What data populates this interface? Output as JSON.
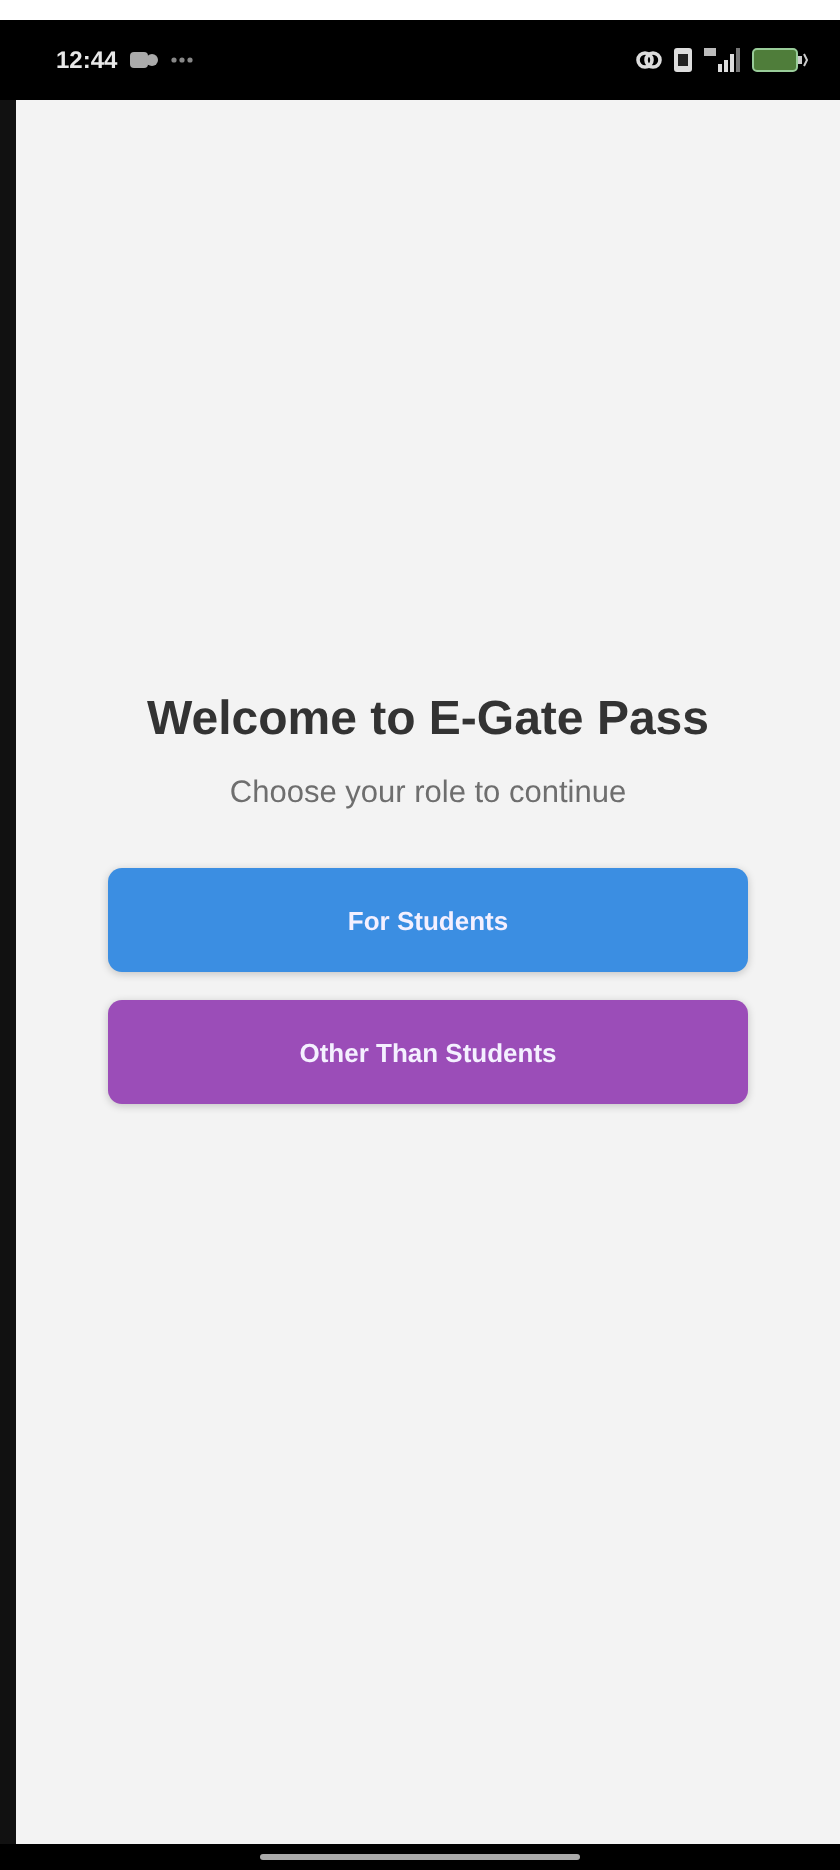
{
  "status_bar": {
    "time": "12:44"
  },
  "title": "Welcome to E-Gate Pass",
  "subtitle": "Choose your role to continue",
  "buttons": [
    {
      "label": "For Students",
      "color": "#3b8ee2"
    },
    {
      "label": "Other Than Students",
      "color": "#9b4db8"
    }
  ]
}
